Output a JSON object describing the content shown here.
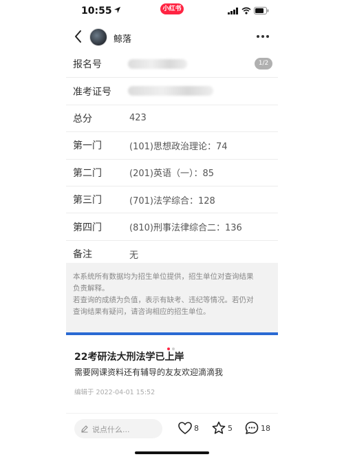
{
  "status_bar": {
    "time": "10:55",
    "app_badge": "小红书"
  },
  "header": {
    "author": "鲸落",
    "icons": [
      "back-icon",
      "avatar",
      "more-icon"
    ]
  },
  "image": {
    "page_indicator": "1/2",
    "rows": [
      {
        "label": "报名号",
        "value": ""
      },
      {
        "label": "准考证号",
        "value": ""
      },
      {
        "label": "总分",
        "value": "423"
      },
      {
        "label": "第一门",
        "value": "(101)思想政治理论：74"
      },
      {
        "label": "第二门",
        "value": "(201)英语（一）：85"
      },
      {
        "label": "第三门",
        "value": "(701)法学综合：128"
      },
      {
        "label": "第四门",
        "value": "(810)刑事法律综合二：136"
      },
      {
        "label": "备注",
        "value": "无"
      }
    ],
    "notice_line1": "本系统所有数据均为招生单位提供，招生单位对查询结果",
    "notice_line2": "负责解释。",
    "notice_line3": "若查询的成绩为负值，表示有缺考、违纪等情况。若仍对",
    "notice_line4": "查询结果有疑问，请咨询相应的招生单位。",
    "accent_color": "#2a6ad3"
  },
  "carousel": {
    "active_index": 0,
    "count": 2,
    "active_color": "#ff2442"
  },
  "post": {
    "title": "22考研法大刑法学已上岸",
    "body": "需要网课资料还有辅导的友友欢迎滴滴我",
    "edited": "编辑于 2022-04-01 15:52"
  },
  "actions": {
    "comment_placeholder": "说点什么...",
    "likes": "8",
    "collects": "5",
    "comments": "18"
  }
}
